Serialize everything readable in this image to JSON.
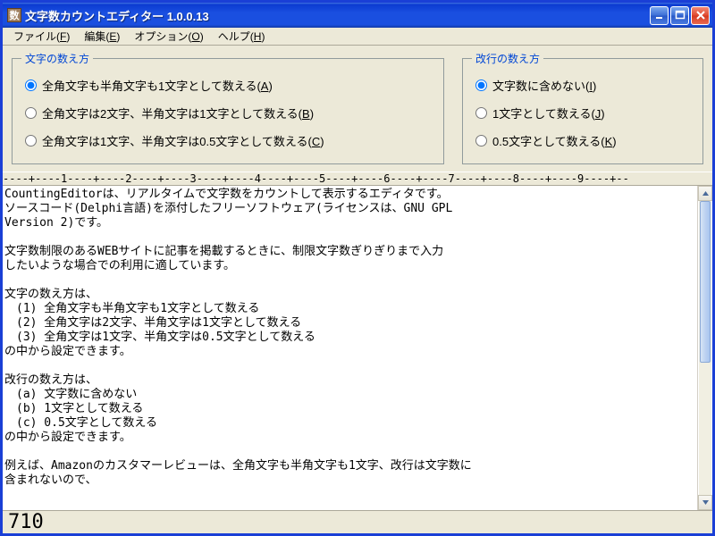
{
  "title": "文字数カウントエディター  1.0.0.13",
  "icon_char": "数",
  "menu": {
    "file": {
      "label": "ファイル",
      "key": "F"
    },
    "edit": {
      "label": "編集",
      "key": "E"
    },
    "option": {
      "label": "オプション",
      "key": "O"
    },
    "help": {
      "label": "ヘルプ",
      "key": "H"
    }
  },
  "char_group_title": "文字の数え方",
  "char_opts": [
    {
      "label_pre": "全角文字も半角文字も1文字として数える(",
      "key": "A",
      "label_post": ")",
      "checked": true
    },
    {
      "label_pre": "全角文字は2文字、半角文字は1文字として数える(",
      "key": "B",
      "label_post": ")",
      "checked": false
    },
    {
      "label_pre": "全角文字は1文字、半角文字は0.5文字として数える(",
      "key": "C",
      "label_post": ")",
      "checked": false
    }
  ],
  "line_group_title": "改行の数え方",
  "line_opts": [
    {
      "label_pre": "文字数に含めない(",
      "key": "I",
      "label_post": ")",
      "checked": true
    },
    {
      "label_pre": "1文字として数える(",
      "key": "J",
      "label_post": ")",
      "checked": false
    },
    {
      "label_pre": "0.5文字として数える(",
      "key": "K",
      "label_post": ")",
      "checked": false
    }
  ],
  "ruler": "----+----1----+----2----+----3----+----4----+----5----+----6----+----7----+----8----+----9----+--",
  "editor_text": "CountingEditorは、リアルタイムで文字数をカウントして表示するエディタです。\nソースコード(Delphi言語)を添付したフリーソフトウェア(ライセンスは、GNU GPL \nVersion 2)です。\n\n文字数制限のあるWEBサイトに記事を掲載するときに、制限文字数ぎりぎりまで入力\nしたいような場合での利用に適しています。\n\n文字の数え方は、\n　(1) 全角文字も半角文字も1文字として数える\n　(2) 全角文字は2文字、半角文字は1文字として数える\n　(3) 全角文字は1文字、半角文字は0.5文字として数える\nの中から設定できます。\n\n改行の数え方は、\n　(a) 文字数に含めない\n　(b) 1文字として数える\n　(c) 0.5文字として数える\nの中から設定できます。\n\n例えば、Amazonのカスタマーレビューは、全角文字も半角文字も1文字、改行は文字数に\n含まれないので、",
  "count": "710"
}
